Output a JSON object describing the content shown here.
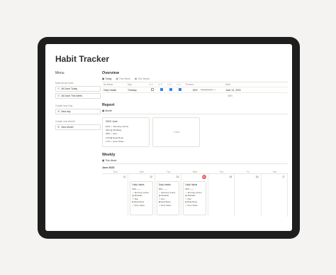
{
  "page": {
    "title": "Habit Tracker"
  },
  "menu": {
    "heading": "Menu",
    "groups": [
      {
        "caption": "Mark all as Done",
        "buttons": [
          "All Done Today",
          "All Done This Week"
        ]
      },
      {
        "caption": "Create new Day",
        "buttons": [
          "New day"
        ]
      },
      {
        "caption": "Create new Month",
        "buttons": [
          "New Month"
        ]
      }
    ]
  },
  "overview": {
    "title": "Overview",
    "tabs": [
      "Today",
      "This Week",
      "This Month"
    ],
    "columns": [
      "Aa Name",
      "Day",
      "☑ 1",
      "☑ 2",
      "☑ 3",
      "☑ 4",
      "Percent",
      "Date"
    ],
    "row": {
      "name": "Daily Habits",
      "day": "Tuesday",
      "checks": [
        false,
        true,
        true,
        true
      ],
      "percent_label": "80%",
      "percent": 0.8,
      "date": "June 13, 2023"
    },
    "footer": "80%"
  },
  "report": {
    "title": "Report",
    "tab": "Month",
    "card": {
      "title": "2023 June",
      "lines": [
        "83% ☼ Morning routine",
        "96% ◍ Meditate",
        "98% ⚐ Run",
        "13% ■ Read Book",
        "77% ✓ Root Tasks"
      ]
    },
    "new_label": "+ New"
  },
  "weekly": {
    "title": "Weekly",
    "tab": "This Week",
    "month": "June 2023",
    "days": [
      "Sun",
      "Mon",
      "Tue",
      "Wed",
      "Thu",
      "Fri",
      "Sat"
    ],
    "dates": [
      "11",
      "12",
      "13",
      "14",
      "15",
      "16",
      "17"
    ],
    "cards": [
      {
        "title": "Daily Habits",
        "lines": [
          "80% ——",
          "☼ Morning routine",
          "◍ Meditate",
          "⚐ Run",
          "■ Read Book",
          "✓ Root Tasks"
        ]
      },
      {
        "title": "Daily Habits",
        "lines": [
          "80% ——",
          "☼ Morning routine",
          "◍ Meditate",
          "⚐ Run",
          "■ Read Book",
          "✓ Root Tasks"
        ]
      },
      {
        "title": "Daily Habits",
        "lines": [
          "80% ——",
          "☼ Morning routine",
          "◍ Meditate",
          "⚐ Run",
          "■ Read Book",
          "✓ Root Tasks"
        ]
      }
    ]
  }
}
